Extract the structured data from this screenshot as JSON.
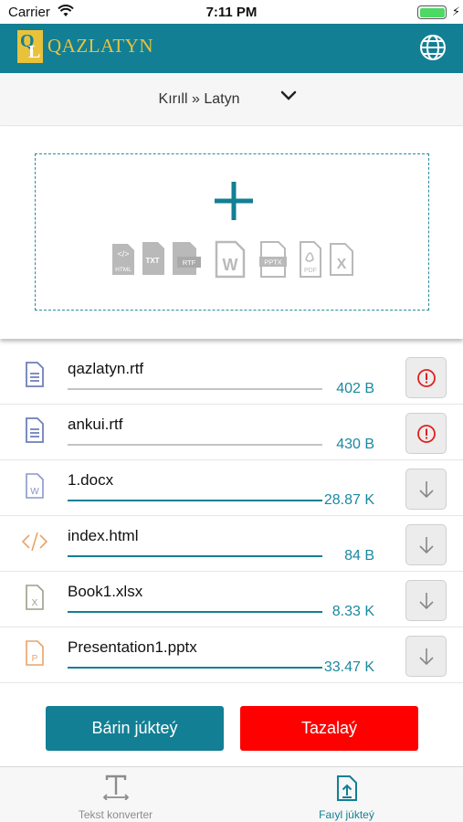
{
  "status_bar": {
    "carrier": "Carrier",
    "time": "7:11 PM"
  },
  "header": {
    "logo_letters": "QL",
    "title": "QAZLATYN",
    "globe_icon": "globe-icon"
  },
  "direction": {
    "label": "Kırıll » Latyn"
  },
  "drop_zone": {
    "add_icon": "plus-icon",
    "types": [
      "HTML",
      "TXT",
      "RTF",
      "W",
      "PPTX",
      "PDF",
      "X"
    ]
  },
  "files": [
    {
      "name": "qazlatyn.rtf",
      "size": "402 B",
      "icon": "rtf-file-icon",
      "status": "error",
      "progress": 1.0
    },
    {
      "name": "ankui.rtf",
      "size": "430 B",
      "icon": "rtf-file-icon",
      "status": "error",
      "progress": 1.0
    },
    {
      "name": "1.docx",
      "size": "28.87 K",
      "icon": "word-file-icon",
      "status": "done",
      "progress": 1.0
    },
    {
      "name": "index.html",
      "size": "84 B",
      "icon": "html-file-icon",
      "status": "done",
      "progress": 1.0
    },
    {
      "name": "Book1.xlsx",
      "size": "8.33 K",
      "icon": "excel-file-icon",
      "status": "done",
      "progress": 1.0
    },
    {
      "name": "Presentation1.pptx",
      "size": "33.47 K",
      "icon": "powerpoint-file-icon",
      "status": "done",
      "progress": 1.0
    }
  ],
  "actions": {
    "download_all": "Bárin júkteý",
    "clear": "Tazalaý"
  },
  "tabs": [
    {
      "label": "Tekst konverter",
      "active": false
    },
    {
      "label": "Faıyl júkteý",
      "active": true
    }
  ],
  "colors": {
    "brand": "#127f94",
    "accent": "#e9c23b",
    "danger": "#ff0000",
    "size_text": "#1a89a0"
  }
}
